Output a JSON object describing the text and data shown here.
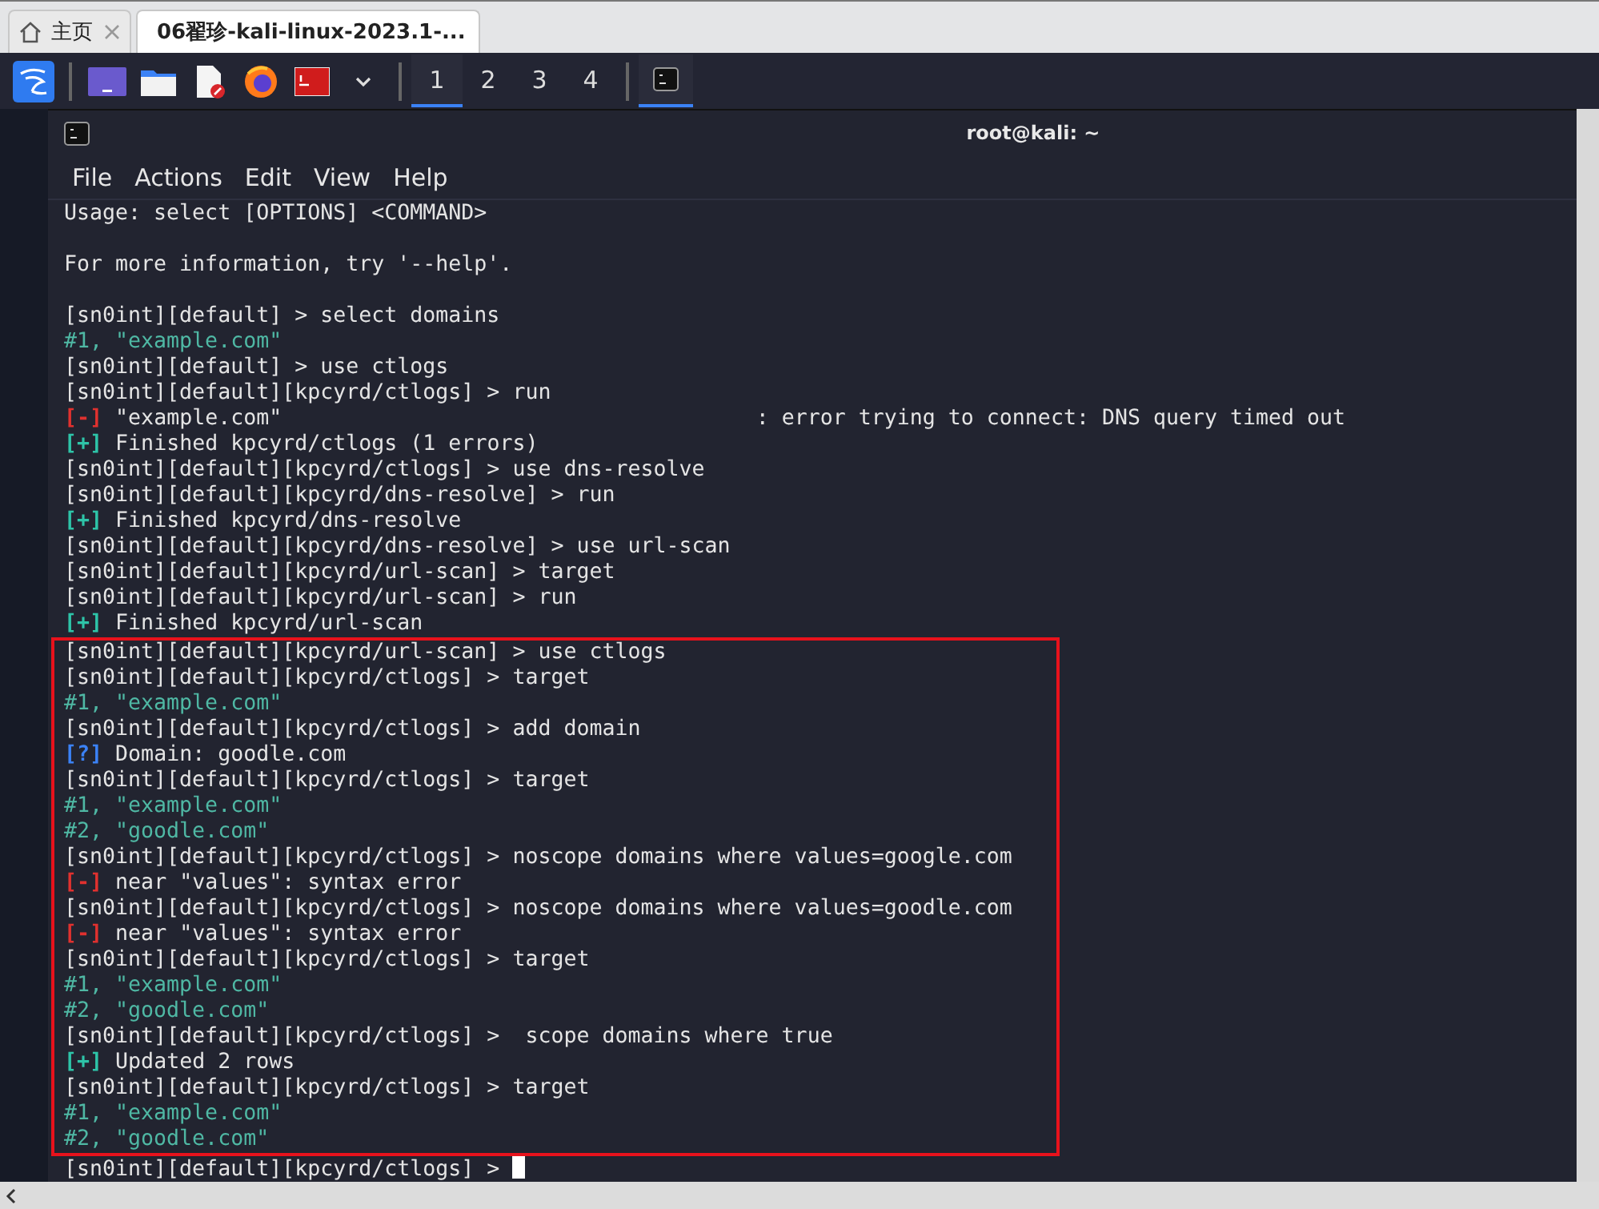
{
  "browser_tabs": [
    {
      "label": "主页",
      "selected": false
    },
    {
      "label": "06翟珍-kali-linux-2023.1-...",
      "selected": true
    }
  ],
  "taskbar": {
    "workspaces": [
      {
        "label": "1",
        "selected": true
      },
      {
        "label": "2",
        "selected": false
      },
      {
        "label": "3",
        "selected": false
      },
      {
        "label": "4",
        "selected": false
      }
    ],
    "tasks": [
      {
        "selected": true
      }
    ]
  },
  "terminal": {
    "title": "root@kali: ~",
    "menu": [
      "File",
      "Actions",
      "Edit",
      "View",
      "Help"
    ],
    "lines": [
      {
        "kind": "plain",
        "text": "Usage: select [OPTIONS] <COMMAND>"
      },
      {
        "kind": "blank"
      },
      {
        "kind": "plain",
        "text": "For more information, try '--help'."
      },
      {
        "kind": "blank"
      },
      {
        "kind": "plain",
        "text": "[sn0int][default] > select domains"
      },
      {
        "kind": "result",
        "text": "#1, \"example.com\""
      },
      {
        "kind": "plain",
        "text": "[sn0int][default] > use ctlogs"
      },
      {
        "kind": "plain",
        "text": "[sn0int][default][kpcyrd/ctlogs] > run"
      },
      {
        "kind": "error",
        "mark": "[-]",
        "text": "\"example.com\"                                     : error trying to connect: DNS query timed out"
      },
      {
        "kind": "success",
        "mark": "[+]",
        "text": "Finished kpcyrd/ctlogs (1 errors)"
      },
      {
        "kind": "plain",
        "text": "[sn0int][default][kpcyrd/ctlogs] > use dns-resolve"
      },
      {
        "kind": "plain",
        "text": "[sn0int][default][kpcyrd/dns-resolve] > run"
      },
      {
        "kind": "success",
        "mark": "[+]",
        "text": "Finished kpcyrd/dns-resolve"
      },
      {
        "kind": "plain",
        "text": "[sn0int][default][kpcyrd/dns-resolve] > use url-scan"
      },
      {
        "kind": "plain",
        "text": "[sn0int][default][kpcyrd/url-scan] > target"
      },
      {
        "kind": "plain",
        "text": "[sn0int][default][kpcyrd/url-scan] > run"
      },
      {
        "kind": "success",
        "mark": "[+]",
        "text": "Finished kpcyrd/url-scan"
      }
    ],
    "highlighted_lines": [
      {
        "kind": "plain",
        "text": "[sn0int][default][kpcyrd/url-scan] > use ctlogs"
      },
      {
        "kind": "plain",
        "text": "[sn0int][default][kpcyrd/ctlogs] > target"
      },
      {
        "kind": "result",
        "text": "#1, \"example.com\""
      },
      {
        "kind": "plain",
        "text": "[sn0int][default][kpcyrd/ctlogs] > add domain"
      },
      {
        "kind": "question",
        "mark": "[?]",
        "text": "Domain: goodle.com"
      },
      {
        "kind": "plain",
        "text": "[sn0int][default][kpcyrd/ctlogs] > target"
      },
      {
        "kind": "result",
        "text": "#1, \"example.com\""
      },
      {
        "kind": "result",
        "text": "#2, \"goodle.com\""
      },
      {
        "kind": "plain",
        "text": "[sn0int][default][kpcyrd/ctlogs] > noscope domains where values=google.com"
      },
      {
        "kind": "error",
        "mark": "[-]",
        "text": "near \"values\": syntax error"
      },
      {
        "kind": "plain",
        "text": "[sn0int][default][kpcyrd/ctlogs] > noscope domains where values=goodle.com"
      },
      {
        "kind": "error",
        "mark": "[-]",
        "text": "near \"values\": syntax error"
      },
      {
        "kind": "plain",
        "text": "[sn0int][default][kpcyrd/ctlogs] > target"
      },
      {
        "kind": "result",
        "text": "#1, \"example.com\""
      },
      {
        "kind": "result",
        "text": "#2, \"goodle.com\""
      },
      {
        "kind": "plain",
        "text": "[sn0int][default][kpcyrd/ctlogs] >  scope domains where true"
      },
      {
        "kind": "success",
        "mark": "[+]",
        "text": "Updated 2 rows"
      },
      {
        "kind": "plain",
        "text": "[sn0int][default][kpcyrd/ctlogs] > target"
      },
      {
        "kind": "result",
        "text": "#1, \"example.com\""
      },
      {
        "kind": "result",
        "text": "#2, \"goodle.com\""
      }
    ],
    "prompt": "[sn0int][default][kpcyrd/ctlogs] >"
  }
}
